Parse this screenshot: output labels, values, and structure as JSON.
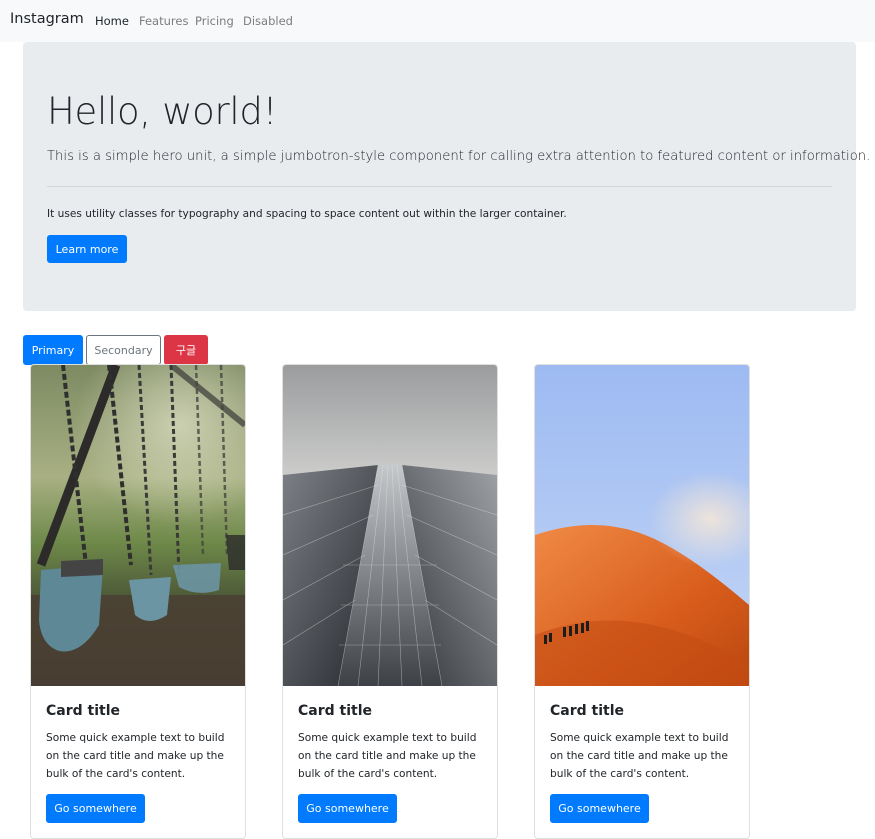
{
  "navbar": {
    "brand": "Instagram",
    "links": [
      {
        "label": "Home",
        "active": true
      },
      {
        "label": "Features",
        "active": false
      },
      {
        "label": "Pricing",
        "active": false
      },
      {
        "label": "Disabled",
        "active": false
      }
    ]
  },
  "jumbotron": {
    "title": "Hello, world!",
    "lead": "This is a simple hero unit, a simple jumbotron-style component for calling extra attention to featured content or information.",
    "text": "It uses utility classes for typography and spacing to space content out within the larger container.",
    "button": "Learn more"
  },
  "buttons": {
    "primary": "Primary",
    "secondary": "Secondary",
    "danger": "구글"
  },
  "cards": [
    {
      "image": "swing-photo",
      "title": "Card title",
      "text": "Some quick example text to build on the card title and make up the bulk of the card's content.",
      "button": "Go somewhere"
    },
    {
      "image": "skyscraper-photo",
      "title": "Card title",
      "text": "Some quick example text to build on the card title and make up the bulk of the card's content.",
      "button": "Go somewhere"
    },
    {
      "image": "desert-dune-photo",
      "title": "Card title",
      "text": "Some quick example text to build on the card title and make up the bulk of the card's content.",
      "button": "Go somewhere"
    }
  ],
  "colors": {
    "primary": "#007bff",
    "secondary": "#6c757d",
    "danger": "#dc3545",
    "jumbotron_bg": "#e9ecef",
    "navbar_bg": "#f8f9fa"
  }
}
